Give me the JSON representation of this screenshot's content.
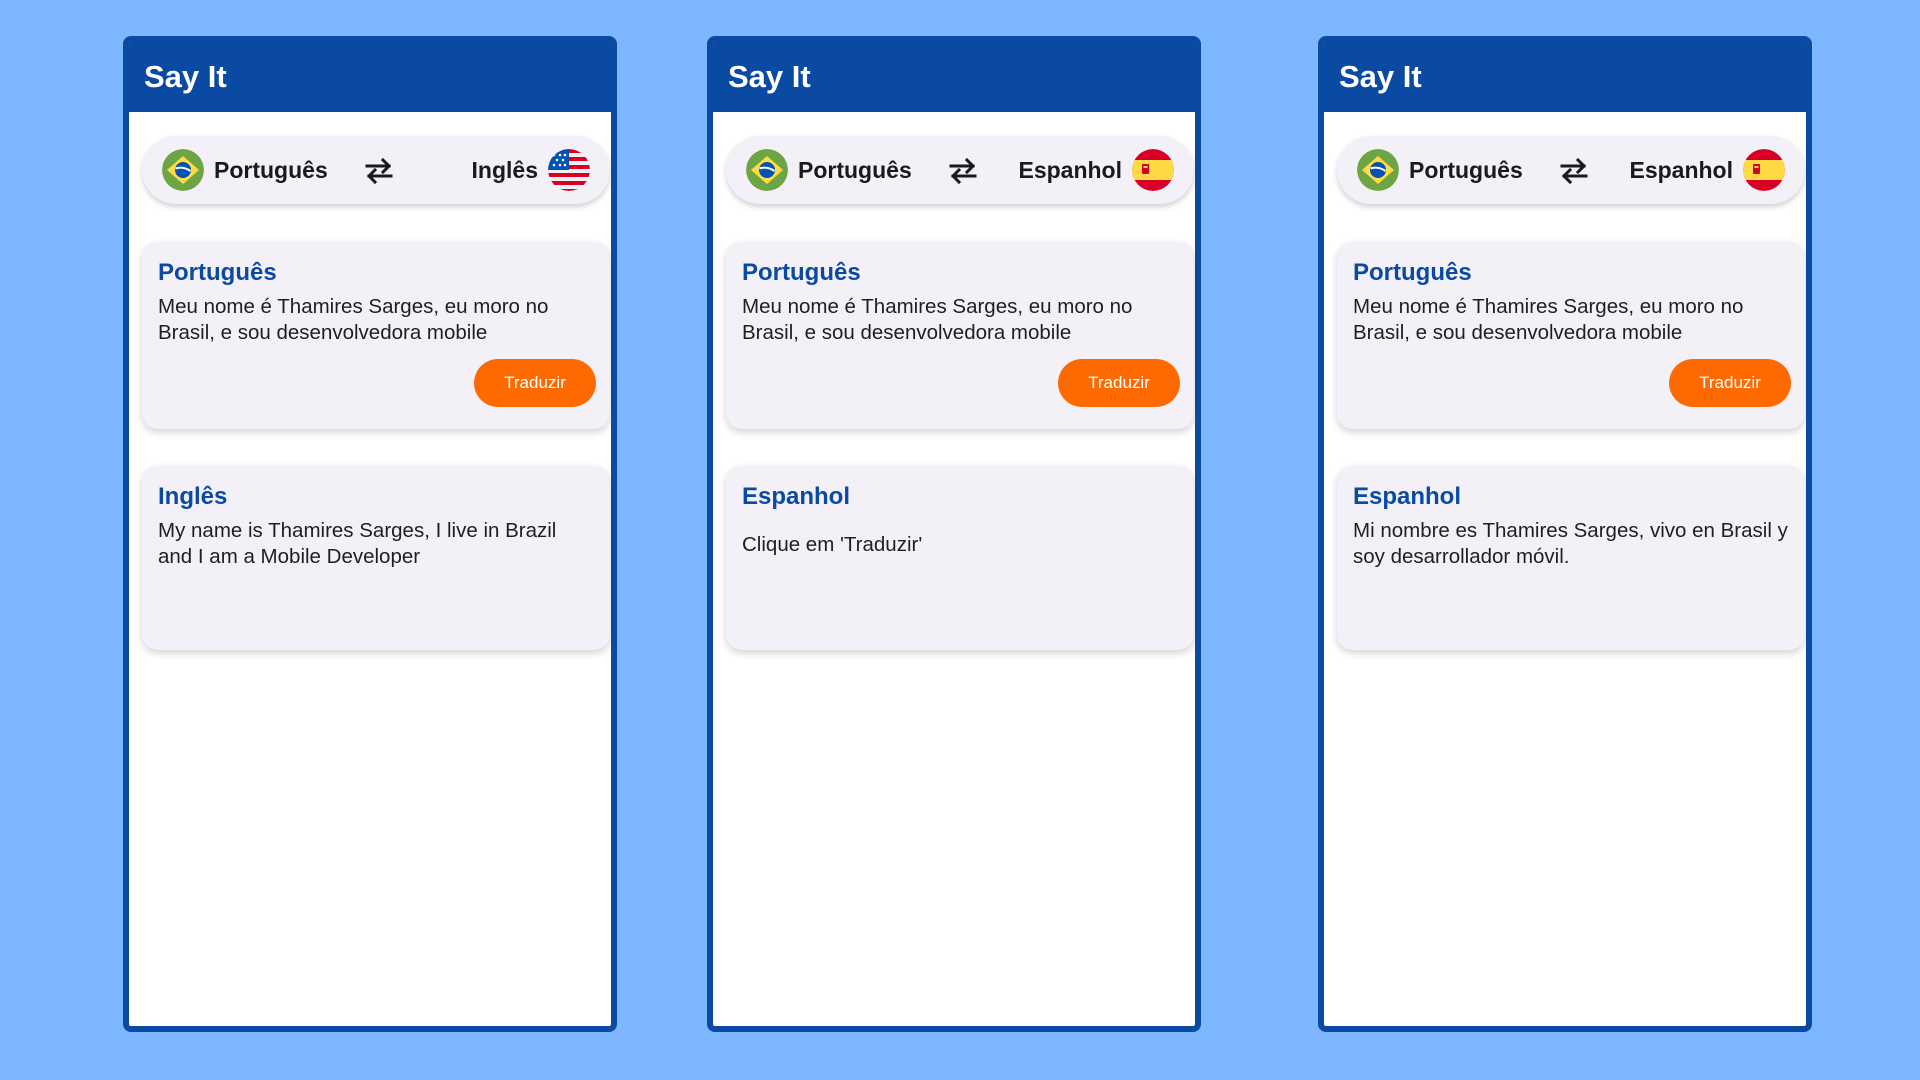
{
  "colors": {
    "background": "#7cb7ff",
    "appbar": "#0a4aa3",
    "accent_button": "#ff6a00",
    "card": "#f4f0f8",
    "title_blue": "#0a4aa3"
  },
  "screens": [
    {
      "app_title": "Say It",
      "lang_bar": {
        "source": {
          "label": "Português",
          "flag_icon": "brazil-flag-icon"
        },
        "swap_icon": "swap-arrows-icon",
        "target": {
          "label": "Inglês",
          "flag_icon": "usa-flag-icon"
        }
      },
      "source_card": {
        "title": "Português",
        "text": "Meu nome é Thamires Sarges, eu moro no Brasil, e sou desenvolvedora mobile",
        "button_label": "Traduzir"
      },
      "target_card": {
        "title": "Inglês",
        "text": "My name is Thamires Sarges, I live in Brazil and I am a Mobile Developer"
      }
    },
    {
      "app_title": "Say It",
      "lang_bar": {
        "source": {
          "label": "Português",
          "flag_icon": "brazil-flag-icon"
        },
        "swap_icon": "swap-arrows-icon",
        "target": {
          "label": "Espanhol",
          "flag_icon": "spain-flag-icon"
        }
      },
      "source_card": {
        "title": "Português",
        "text": "Meu nome é Thamires Sarges, eu moro no Brasil, e sou desenvolvedora mobile",
        "button_label": "Traduzir"
      },
      "target_card": {
        "title": "Espanhol",
        "text": "Clique em 'Traduzir'"
      }
    },
    {
      "app_title": "Say It",
      "lang_bar": {
        "source": {
          "label": "Português",
          "flag_icon": "brazil-flag-icon"
        },
        "swap_icon": "swap-arrows-icon",
        "target": {
          "label": "Espanhol",
          "flag_icon": "spain-flag-icon"
        }
      },
      "source_card": {
        "title": "Português",
        "text": "Meu nome é Thamires Sarges, eu moro no Brasil, e sou desenvolvedora mobile",
        "button_label": "Traduzir"
      },
      "target_card": {
        "title": "Espanhol",
        "text": "Mi nombre es Thamires Sarges, vivo en Brasil y soy desarrollador móvil."
      }
    }
  ]
}
